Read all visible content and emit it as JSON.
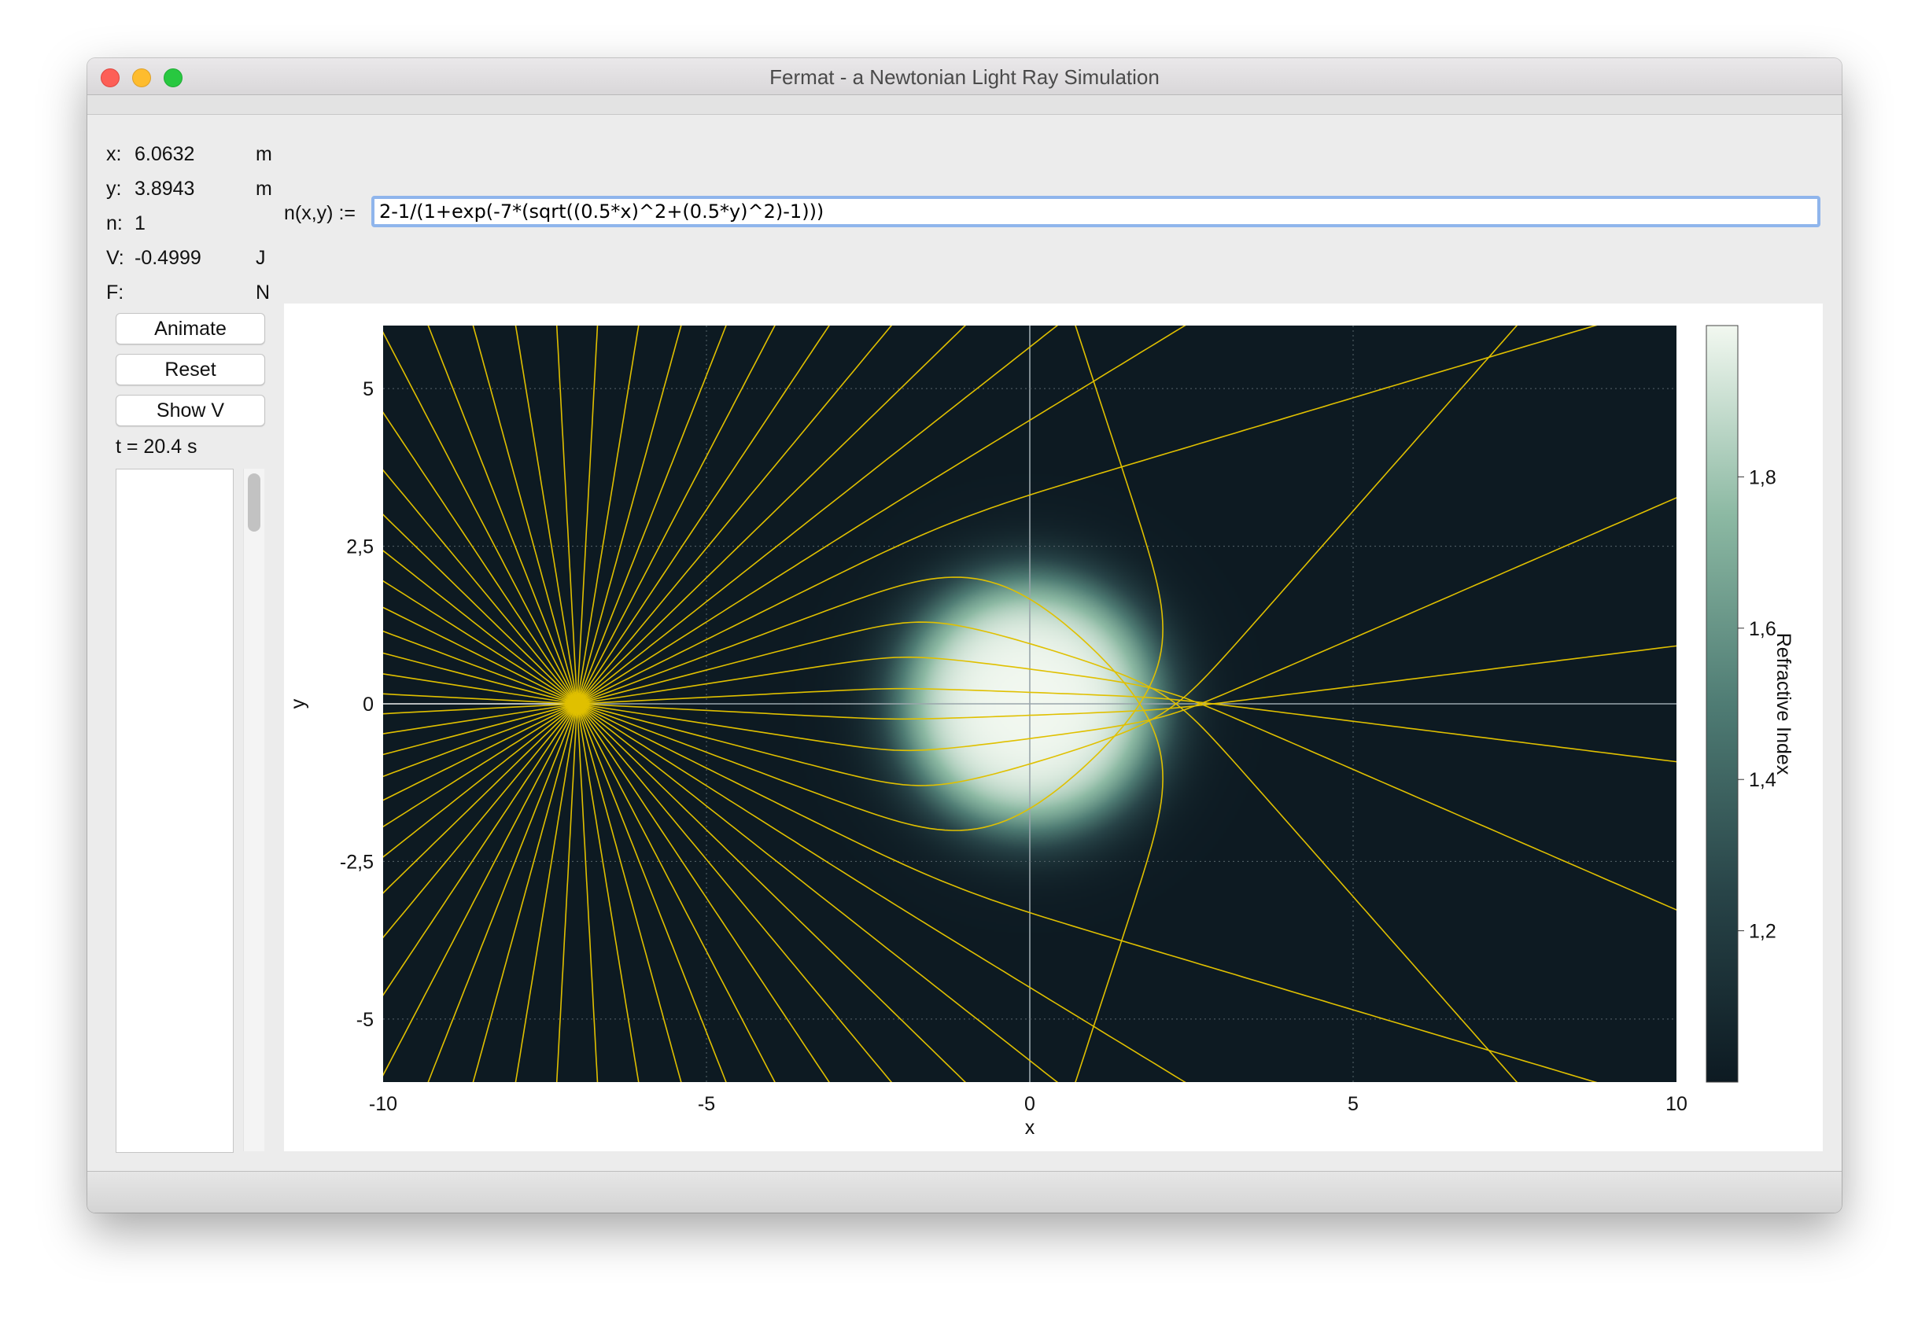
{
  "window": {
    "title": "Fermat - a Newtonian Light Ray Simulation"
  },
  "info": [
    {
      "label": "x:",
      "value": "6.0632",
      "unit": "m"
    },
    {
      "label": "y:",
      "value": "3.8943",
      "unit": "m"
    },
    {
      "label": "n:",
      "value": "1",
      "unit": ""
    },
    {
      "label": "V:",
      "value": "-0.4999",
      "unit": "J"
    },
    {
      "label": "F:",
      "value": "",
      "unit": "N"
    }
  ],
  "formula": {
    "label": "n(x,y) :=",
    "value": "2-1/(1+exp(-7*(sqrt((0.5*x)^2+(0.5*y)^2)-1)))"
  },
  "buttons": {
    "animate": "Animate",
    "reset": "Reset",
    "show_v": "Show V"
  },
  "time_label": "t = 20.4 s",
  "colors": {
    "plot_bg": "#0d1a22",
    "ray": "#e0c000",
    "focus_ring": "#8fb5ec"
  },
  "chart_data": {
    "type": "heatmap",
    "title": "",
    "xlabel": "x",
    "ylabel": "y",
    "xlim": [
      -10,
      10
    ],
    "ylim": [
      -6,
      6
    ],
    "x_ticks": [
      "-10",
      "-5",
      "0",
      "5",
      "10"
    ],
    "x_tick_values": [
      -10,
      -5,
      0,
      5,
      10
    ],
    "y_ticks": [
      "5",
      "2,5",
      "0",
      "-2,5",
      "-5"
    ],
    "y_tick_values": [
      5,
      2.5,
      0,
      -2.5,
      -5
    ],
    "grid": true,
    "field": "n(x,y) = 2-1/(1+exp(-7*(sqrt((0.5*x)^2+(0.5*y)^2)-1)))",
    "colorbar": {
      "label": "Refractive Index",
      "ticks": [
        "1,8",
        "1,6",
        "1,4",
        "1,2"
      ],
      "tick_values": [
        1.8,
        1.6,
        1.4,
        1.2
      ],
      "range": [
        1.0,
        2.0
      ]
    },
    "rays": {
      "source": [
        -7,
        0
      ],
      "count": 60,
      "color": "#e0c000"
    }
  }
}
